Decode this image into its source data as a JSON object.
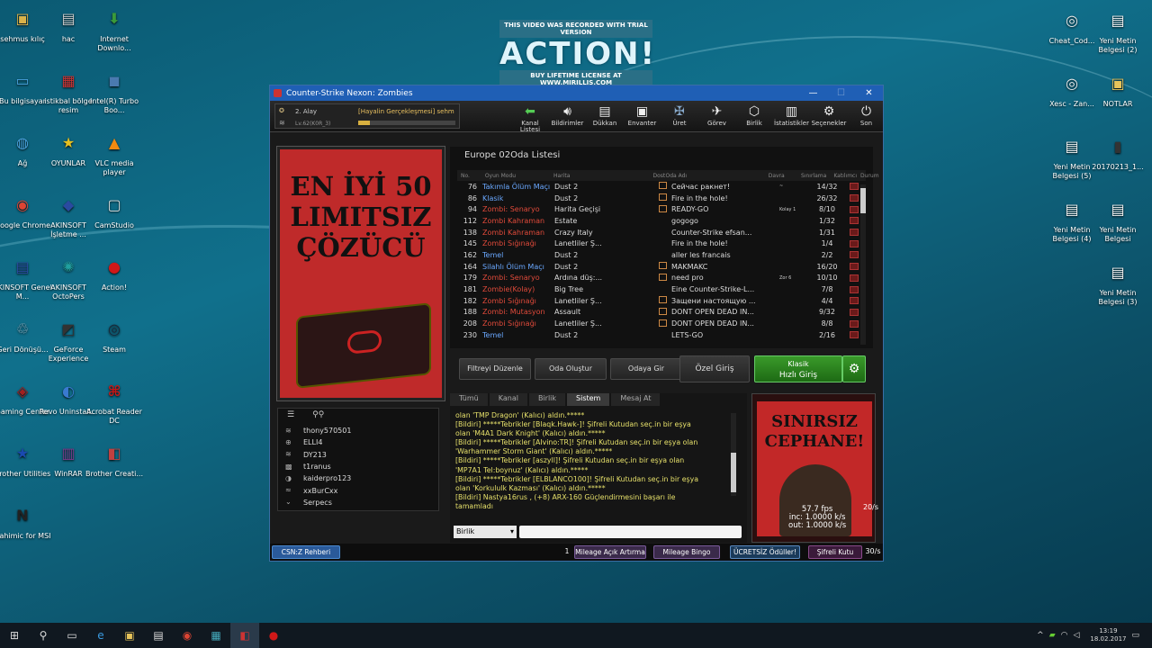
{
  "watermark": {
    "top": "THIS VIDEO WAS RECORDED WITH TRIAL VERSION",
    "brand": "ACTION!",
    "bottom": "BUY LIFETIME LICENSE AT WWW.MIRILLIS.COM"
  },
  "desktop_left": [
    {
      "label": "sehmus kılıç",
      "icon": "folder-icon",
      "color": "#d9b24a",
      "glyph": "▣"
    },
    {
      "label": "hac",
      "icon": "document-icon",
      "color": "#ccc",
      "glyph": "▤"
    },
    {
      "label": "Internet Downlo...",
      "icon": "idm-icon",
      "color": "#3a9a3a",
      "glyph": "⬇"
    },
    {
      "label": "Bu bilgisayar",
      "icon": "computer-icon",
      "color": "#4aa3df",
      "glyph": "▭"
    },
    {
      "label": "istikbal bölge resim",
      "icon": "archive-icon",
      "color": "#c33",
      "glyph": "▦"
    },
    {
      "label": "Intel(R) Turbo Boo...",
      "icon": "intel-icon",
      "color": "#4a7ab0",
      "glyph": "◼"
    },
    {
      "label": "Ağ",
      "icon": "network-icon",
      "color": "#4aa3df",
      "glyph": "◍"
    },
    {
      "label": "OYUNLAR",
      "icon": "star-icon",
      "color": "#e6c020",
      "glyph": "★"
    },
    {
      "label": "VLC media player",
      "icon": "vlc-icon",
      "color": "#f08a10",
      "glyph": "▲"
    },
    {
      "label": "Google Chrome",
      "icon": "chrome-icon",
      "color": "#dd4433",
      "glyph": "◉"
    },
    {
      "label": "AKINSOFT İşletme ...",
      "icon": "akinsoft-icon",
      "color": "#2a4aa0",
      "glyph": "◆"
    },
    {
      "label": "CamStudio",
      "icon": "camstudio-icon",
      "color": "#ddd",
      "glyph": "▢"
    },
    {
      "label": "AKINSOFT Genel M...",
      "icon": "akinsoft-doc-icon",
      "color": "#2a4aa0",
      "glyph": "▤"
    },
    {
      "label": "AKINSOFT OctoPers",
      "icon": "octopus-icon",
      "color": "#20a0a0",
      "glyph": "✺"
    },
    {
      "label": "Action!",
      "icon": "record-icon",
      "color": "#d01818",
      "glyph": "●"
    },
    {
      "label": "Geri Dönüşü...",
      "icon": "recycle-bin-icon",
      "color": "#8ab",
      "glyph": "♲"
    },
    {
      "label": "GeForce Experience",
      "icon": "geforce-icon",
      "color": "#333",
      "glyph": "◩"
    },
    {
      "label": "Steam",
      "icon": "steam-icon",
      "color": "#1b2838",
      "glyph": "◎"
    },
    {
      "label": "Gaming Center",
      "icon": "gaming-center-icon",
      "color": "#a02020",
      "glyph": "◈"
    },
    {
      "label": "Revo Uninstall...",
      "icon": "revo-icon",
      "color": "#3a7ad0",
      "glyph": "◐"
    },
    {
      "label": "Acrobat Reader DC",
      "icon": "acrobat-icon",
      "color": "#c81818",
      "glyph": "⌘"
    },
    {
      "label": "Brother Utilities",
      "icon": "brother-icon",
      "color": "#1a4ab0",
      "glyph": "★"
    },
    {
      "label": "WinRAR",
      "icon": "winrar-icon",
      "color": "#7a3a8a",
      "glyph": "▥"
    },
    {
      "label": "Brother Creati...",
      "icon": "brother-creative-icon",
      "color": "#c04040",
      "glyph": "◧"
    },
    {
      "label": "Nahimic for MSI",
      "icon": "nahimic-icon",
      "color": "#222",
      "glyph": "N"
    }
  ],
  "desktop_right": [
    {
      "label": "Cheat_Cod...",
      "icon": "url-icon",
      "color": "#eee",
      "glyph": "◎"
    },
    {
      "label": "Yeni Metin Belgesi (2)",
      "icon": "text-file-icon",
      "color": "#f4f4f4",
      "glyph": "▤"
    },
    {
      "label": "Xesc - Zan...",
      "icon": "url-icon-2",
      "color": "#eee",
      "glyph": "◎"
    },
    {
      "label": "NOTLAR",
      "icon": "notes-folder-icon",
      "color": "#e6c35a",
      "glyph": "▣"
    },
    {
      "label": "Yeni Metin Belgesi (5)",
      "icon": "text-file-icon-5",
      "color": "#f4f4f4",
      "glyph": "▤"
    },
    {
      "label": "20170213_1...",
      "icon": "video-file-icon",
      "color": "#333",
      "glyph": "▮"
    },
    {
      "label": "Yeni Metin Belgesi (4)",
      "icon": "text-file-icon-4",
      "color": "#f4f4f4",
      "glyph": "▤"
    },
    {
      "label": "Yeni Metin Belgesi",
      "icon": "text-file-icon-1",
      "color": "#f4f4f4",
      "glyph": "▤"
    },
    {
      "label": "Yeni Metin Belgesi (3)",
      "icon": "text-file-icon-3",
      "color": "#f4f4f4",
      "glyph": "▤"
    }
  ],
  "window": {
    "title": "Counter-Strike Nexon: Zombies",
    "player": {
      "rank": "2. Alay",
      "clan": "[Hayalin Gerçekleşmesi] sehm",
      "level": "Lv.62(K0R_3)"
    },
    "menu": [
      {
        "label": "Kanal Listesi",
        "icon": "back-arrow-icon",
        "glyph": "⬅",
        "color": "#5c5"
      },
      {
        "label": "Bildirimler",
        "icon": "speaker-icon",
        "glyph": "🔊︎",
        "color": "#eee"
      },
      {
        "label": "Dükkan",
        "icon": "shop-icon",
        "glyph": "▤",
        "color": "#eee"
      },
      {
        "label": "Envanter",
        "icon": "inventory-icon",
        "glyph": "▣",
        "color": "#eee"
      },
      {
        "label": "Üret",
        "icon": "craft-icon",
        "glyph": "✠",
        "color": "#8ac"
      },
      {
        "label": "Görev",
        "icon": "mission-icon",
        "glyph": "✈",
        "color": "#eee"
      },
      {
        "label": "Birlik",
        "icon": "clan-icon",
        "glyph": "⬡",
        "color": "#eee"
      },
      {
        "label": "İstatistikler",
        "icon": "stats-icon",
        "glyph": "▥",
        "color": "#eee"
      },
      {
        "label": "Seçenekler",
        "icon": "gear-icon",
        "glyph": "⚙",
        "color": "#eee"
      },
      {
        "label": "Son",
        "icon": "power-icon",
        "glyph": "⏻",
        "color": "#eee"
      }
    ],
    "left_banner": {
      "line1": "EN İYİ 50",
      "line2": "LIMITSIZ",
      "line3": "ÇÖZÜCÜ"
    },
    "room_list": {
      "title": "Europe 02Oda Listesi",
      "headers": [
        "No.",
        "Oyun Modu",
        "Harita",
        "Dost",
        "Oda Adı",
        "Davra",
        "Sınırlama",
        "Katılımcı",
        "Durum"
      ],
      "rows": [
        {
          "no": "76",
          "mode": "Takımla Ölüm Maçı",
          "modeColor": "#6aa8ff",
          "map": "Dust 2",
          "tag": true,
          "name": "Сейчас ракнет!",
          "rank": "~",
          "count": "14/32"
        },
        {
          "no": "86",
          "mode": "Klasik",
          "modeColor": "#6aa8ff",
          "map": "Dust 2",
          "tag": true,
          "name": "Fire in the hole!",
          "rank": "",
          "count": "26/32"
        },
        {
          "no": "94",
          "mode": "Zombi: Senaryo",
          "modeColor": "#e04a3a",
          "map": "Harita Geçişi",
          "tag": true,
          "name": "READY-GO",
          "rank": "Kolay 1",
          "count": "8/10"
        },
        {
          "no": "112",
          "mode": "Zombi Kahraman",
          "modeColor": "#e04a3a",
          "map": "Estate",
          "tag": false,
          "name": "gogogo",
          "rank": "",
          "count": "1/32"
        },
        {
          "no": "138",
          "mode": "Zombi Kahraman",
          "modeColor": "#e04a3a",
          "map": "Crazy Italy",
          "tag": false,
          "name": "Counter-Strike efsan...",
          "rank": "",
          "count": "1/31"
        },
        {
          "no": "145",
          "mode": "Zombi Sığınağı",
          "modeColor": "#e04a3a",
          "map": "Lanetliler Ş...",
          "tag": false,
          "name": "Fire in the hole!",
          "rank": "",
          "count": "1/4"
        },
        {
          "no": "162",
          "mode": "Temel",
          "modeColor": "#6aa8ff",
          "map": "Dust 2",
          "tag": false,
          "name": "aller les francais",
          "rank": "",
          "count": "2/2"
        },
        {
          "no": "164",
          "mode": "Silahlı Ölüm Maçı",
          "modeColor": "#6aa8ff",
          "map": "Dust 2",
          "tag": true,
          "name": "MAKMAKC",
          "rank": "",
          "count": "16/20"
        },
        {
          "no": "179",
          "mode": "Zombi: Senaryo",
          "modeColor": "#e04a3a",
          "map": "Ardına düş:...",
          "tag": true,
          "name": "need pro",
          "rank": "Zor 6",
          "count": "10/10"
        },
        {
          "no": "181",
          "mode": "Zombie(Kolay)",
          "modeColor": "#e04a3a",
          "map": "Big Tree",
          "tag": false,
          "name": "Eine Counter-Strike-L...",
          "rank": "",
          "count": "7/8"
        },
        {
          "no": "182",
          "mode": "Zombi Sığınağı",
          "modeColor": "#e04a3a",
          "map": "Lanetliler Ş...",
          "tag": true,
          "name": "Защени настоящую ...",
          "rank": "",
          "count": "4/4"
        },
        {
          "no": "188",
          "mode": "Zombi: Mutasyon",
          "modeColor": "#e04a3a",
          "map": "Assault",
          "tag": true,
          "name": "DONT OPEN DEAD IN...",
          "rank": "",
          "count": "9/32"
        },
        {
          "no": "208",
          "mode": "Zombi Sığınağı",
          "modeColor": "#e04a3a",
          "map": "Lanetliler Ş...",
          "tag": true,
          "name": "DONT OPEN DEAD IN...",
          "rank": "",
          "count": "8/8"
        },
        {
          "no": "230",
          "mode": "Temel",
          "modeColor": "#6aa8ff",
          "map": "Dust 2",
          "tag": false,
          "name": "LETS-GO",
          "rank": "",
          "count": "2/16"
        }
      ]
    },
    "buttons": {
      "filter": "Filtreyi Düzenle",
      "create": "Oda Oluştur",
      "join": "Odaya Gir",
      "private": "Özel Giriş",
      "quick_top": "Klasik",
      "quick_bottom": "Hızlı Giriş"
    },
    "users": [
      {
        "name": "thony570501",
        "icon": "rank-chevron-icon",
        "glyph": "≋"
      },
      {
        "name": "ELLI4",
        "icon": "rank-cross-icon",
        "glyph": "⊕"
      },
      {
        "name": "DY213",
        "icon": "rank-chevron-icon",
        "glyph": "≋"
      },
      {
        "name": "t1ranus",
        "icon": "rank-badge-icon",
        "glyph": "▩"
      },
      {
        "name": "kaiderpro123",
        "icon": "rank-emblem-icon",
        "glyph": "◑"
      },
      {
        "name": "xxBurCxx",
        "icon": "rank-chevron-icon",
        "glyph": "≈"
      },
      {
        "name": "Serpecs",
        "icon": "rank-chevron-icon",
        "glyph": "⌄"
      }
    ],
    "chat": {
      "tabs": [
        "Tümü",
        "Kanal",
        "Birlik",
        "Sistem",
        "Mesaj At"
      ],
      "active": "Sistem",
      "lines": [
        "olan 'TMP Dragon' (Kalıcı) aldın.*****",
        "[Bildiri] *****Tebrikler [Blaqk.Hawk-]! Şifreli Kutudan seç.in bir eşya",
        "olan 'M4A1 Dark Knight' (Kalıcı) aldın.*****",
        "[Bildiri] *****Tebrikler [AIvino:TR]! Şifreli Kutudan seç.in bir eşya olan",
        "'Warhammer Storm Giant' (Kalıcı) aldın.*****",
        "[Bildiri] *****Tebrikler [aszyll]! Şifreli Kutudan seç.in bir eşya olan",
        "'MP7A1 Tel:boynuz' (Kalıcı) aldın.*****",
        "[Bildiri] *****Tebrikler [ELBLANCO100]! Şifreli Kutudan seç.in bir eşya",
        "olan 'Korkululk Kazması' (Kalıcı) aldın.*****",
        "[Bildiri] Nastya16rus , (+8) ARX-160 Güçlendirmesini başarı ile",
        "tamamladı"
      ],
      "channel": "Birlik"
    },
    "right_ad": {
      "line1": "SINIRSIZ",
      "line2": "CEPHANE!",
      "fps": "57.7 fps",
      "net_in": "inc: 1.0000 k/s",
      "net_out": "out: 1.0000 k/s",
      "side": "20/s"
    },
    "bottom": {
      "guide": "CSN:Z Rehberi",
      "number": "1",
      "b1": "Mileage Açık Artırma",
      "b2": "Mileage Bingo",
      "b3": "ÜCRETSİZ Ödüller!",
      "b4": "Şifreli Kutu",
      "side": "30/s"
    }
  },
  "tray": {
    "time": "13:19",
    "date": "18.02.2017"
  }
}
